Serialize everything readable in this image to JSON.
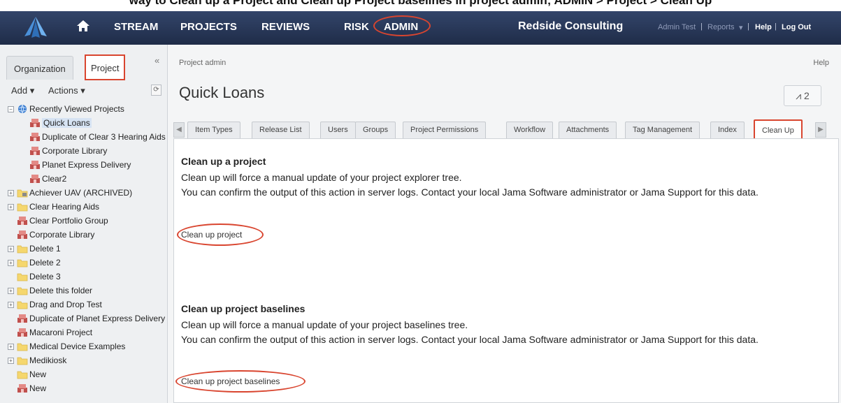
{
  "top_strip": {
    "text": "way to Clean up a Project and Clean up Project baselines in project admin; ADMIN > Project > Clean Up"
  },
  "navbar": {
    "items": [
      {
        "label": "STREAM"
      },
      {
        "label": "PROJECTS"
      },
      {
        "label": "REVIEWS"
      },
      {
        "label": "RISK"
      },
      {
        "label": "ADMIN"
      }
    ],
    "brand": "Redside Consulting",
    "user": "Admin Test",
    "reports": "Reports",
    "help": "Help",
    "logout": "Log Out"
  },
  "left_panel": {
    "tabs": {
      "organization": "Organization",
      "project": "Project"
    },
    "toolbar": {
      "add": "Add ▾",
      "actions": "Actions ▾"
    },
    "tree": [
      {
        "label": "Recently Viewed Projects",
        "icon": "globe-icon",
        "expander": "−"
      },
      {
        "label": "Quick Loans",
        "icon": "project-icon",
        "selected": true
      },
      {
        "label": "Duplicate of Clear 3 Hearing Aids",
        "icon": "project-icon"
      },
      {
        "label": "Corporate Library",
        "icon": "project-icon"
      },
      {
        "label": "Planet Express Delivery",
        "icon": "project-icon"
      },
      {
        "label": "Clear2",
        "icon": "project-icon"
      },
      {
        "label": "Achiever UAV (ARCHIVED)",
        "icon": "archived-folder-icon",
        "expander": "+"
      },
      {
        "label": "Clear Hearing Aids",
        "icon": "folder-icon",
        "expander": "+"
      },
      {
        "label": "Clear Portfolio Group",
        "icon": "project-icon"
      },
      {
        "label": "Corporate Library",
        "icon": "project-icon"
      },
      {
        "label": "Delete 1",
        "icon": "folder-icon",
        "expander": "+"
      },
      {
        "label": "Delete 2",
        "icon": "folder-icon",
        "expander": "+"
      },
      {
        "label": "Delete 3",
        "icon": "folder-icon"
      },
      {
        "label": "Delete this folder",
        "icon": "folder-icon",
        "expander": "+"
      },
      {
        "label": "Drag and Drop Test",
        "icon": "folder-icon",
        "expander": "+"
      },
      {
        "label": "Duplicate of Planet Express Delivery",
        "icon": "project-icon"
      },
      {
        "label": "Macaroni Project",
        "icon": "project-icon"
      },
      {
        "label": "Medical Device Examples",
        "icon": "folder-icon",
        "expander": "+"
      },
      {
        "label": "Medikiosk",
        "icon": "folder-icon",
        "expander": "+"
      },
      {
        "label": "New",
        "icon": "folder-icon"
      },
      {
        "label": "New",
        "icon": "project-icon"
      }
    ]
  },
  "main": {
    "breadcrumb": "Project admin",
    "help": "Help",
    "title": "Quick Loans",
    "activity_count": "2",
    "tabs": [
      {
        "label": "Item Types"
      },
      {
        "label": "Release List"
      },
      {
        "label": "Users"
      },
      {
        "label": "Groups"
      },
      {
        "label": "Project Permissions"
      },
      {
        "label": "Workflow"
      },
      {
        "label": "Attachments"
      },
      {
        "label": "Tag Management"
      },
      {
        "label": "Index"
      },
      {
        "label": "Clean Up",
        "active": true
      }
    ],
    "section1": {
      "title": "Clean up a project",
      "line1": "Clean up will force a manual update of your project explorer tree.",
      "line2": "You can confirm the output of this action in server logs. Contact your local Jama Software administrator or Jama Support for this data.",
      "button": "Clean up project"
    },
    "section2": {
      "title": "Clean up project baselines",
      "line1": "Clean up will force a manual update of your project baselines tree.",
      "line2": "You can confirm the output of this action in server logs. Contact your local Jama Software administrator or Jama Support for this data.",
      "button": "Clean up project baselines"
    }
  },
  "colors": {
    "navbar": "#1f2c48",
    "highlight_red": "#d9452f",
    "selected_row": "#d6e3f3",
    "folder_yellow": "#f5d76e",
    "project_icon": "#c0504d"
  }
}
